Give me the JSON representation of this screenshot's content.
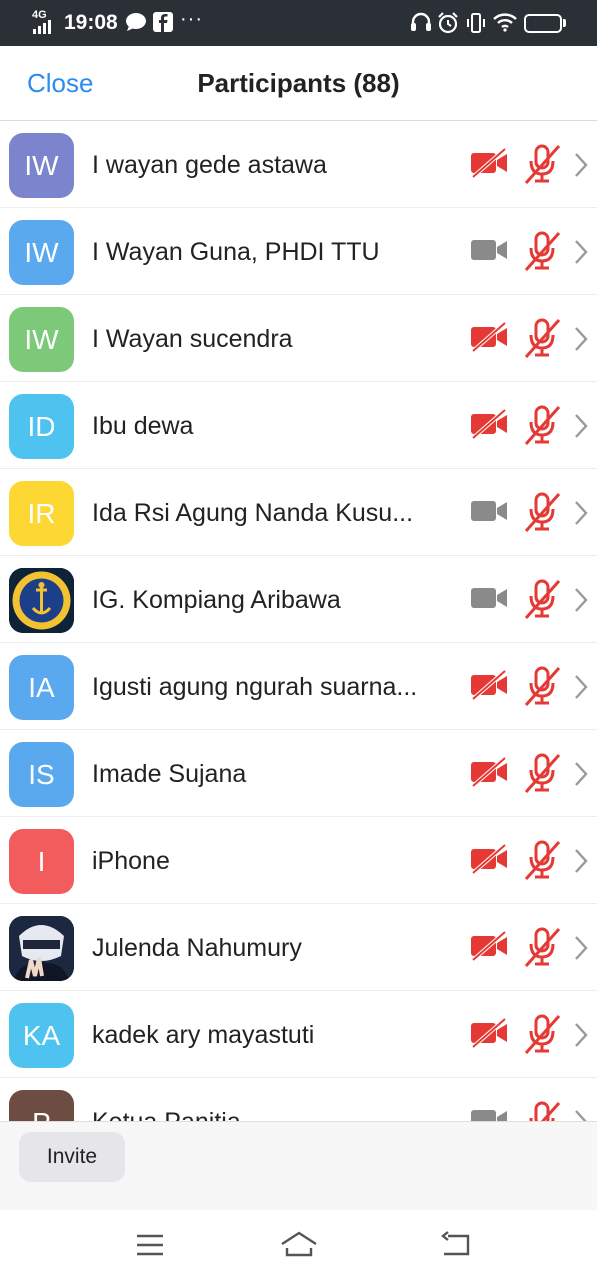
{
  "status_bar": {
    "network": "4G",
    "time": "19:08",
    "battery": "67",
    "battery_fraction": 0.67,
    "icons": [
      "signal-icon",
      "message-icon",
      "facebook-icon",
      "more-dots-icon",
      "headset-icon",
      "alarm-icon",
      "vibrate-icon",
      "wifi-icon",
      "battery-icon"
    ]
  },
  "header": {
    "close_label": "Close",
    "title": "Participants (88)"
  },
  "participants": [
    {
      "name": "I wayan gede astawa",
      "initials": "IW",
      "avatar_color": "#7b84cd",
      "video_on": false,
      "audio_on": false
    },
    {
      "name": "I Wayan Guna, PHDI TTU",
      "initials": "IW",
      "avatar_color": "#5aa9ef",
      "video_on": true,
      "audio_on": false
    },
    {
      "name": "I Wayan sucendra",
      "initials": "IW",
      "avatar_color": "#7dc97a",
      "video_on": false,
      "audio_on": false
    },
    {
      "name": "Ibu dewa",
      "initials": "ID",
      "avatar_color": "#4fc3f0",
      "video_on": false,
      "audio_on": false
    },
    {
      "name": "Ida Rsi Agung Nanda Kusu...",
      "initials": "IR",
      "avatar_color": "#fdd835",
      "video_on": true,
      "audio_on": false
    },
    {
      "name": "IG. Kompiang Aribawa",
      "initials": "",
      "avatar_color": "#0e2238",
      "avatar_image": "emblem",
      "video_on": true,
      "audio_on": false
    },
    {
      "name": "Igusti agung ngurah suarna...",
      "initials": "IA",
      "avatar_color": "#5aa9ef",
      "video_on": false,
      "audio_on": false
    },
    {
      "name": "Imade Sujana",
      "initials": "IS",
      "avatar_color": "#5aa9ef",
      "video_on": false,
      "audio_on": false
    },
    {
      "name": "iPhone",
      "initials": "I",
      "avatar_color": "#f25c5c",
      "video_on": false,
      "audio_on": false
    },
    {
      "name": "Julenda Nahumury",
      "initials": "",
      "avatar_color": "#1c2740",
      "avatar_image": "anime",
      "video_on": false,
      "audio_on": false
    },
    {
      "name": "kadek ary mayastuti",
      "initials": "KA",
      "avatar_color": "#4fc3f0",
      "video_on": false,
      "audio_on": false
    },
    {
      "name": "Ketua Panitia",
      "initials": "P",
      "avatar_color": "#6d4c41",
      "video_on": true,
      "audio_on": false
    }
  ],
  "footer": {
    "invite_label": "Invite"
  },
  "colors": {
    "accent": "#2d8cf0",
    "muted_red": "#e53935",
    "video_gray": "#8a8a8a"
  },
  "nav": {
    "icons": [
      "menu-icon",
      "home-icon",
      "back-icon"
    ]
  }
}
